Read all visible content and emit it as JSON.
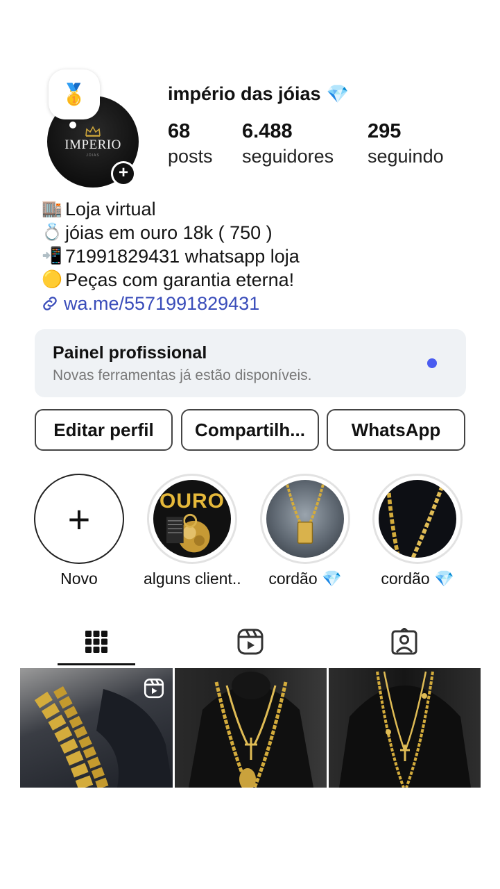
{
  "profile": {
    "username": "império das jóias",
    "verified_emoji": "💎",
    "note_emoji": "🥇",
    "avatar_text": "IMPERIO",
    "avatar_subtext": "JÓIAS",
    "stats": [
      {
        "value": "68",
        "label": "posts"
      },
      {
        "value": "6.488",
        "label": "seguidores"
      },
      {
        "value": "295",
        "label": "seguindo"
      }
    ]
  },
  "bio": {
    "lines": [
      {
        "emoji": "🏬",
        "text": "Loja virtual"
      },
      {
        "emoji": "💍",
        "text": "jóias em ouro 18k ( 750 )"
      },
      {
        "emoji": "📲",
        "text": " 71991829431 whatsapp loja"
      },
      {
        "emoji": "🟡",
        "text": " Peças com garantia eterna!"
      }
    ],
    "link": "wa.me/5571991829431"
  },
  "panel": {
    "title": "Painel profissional",
    "subtitle": "Novas ferramentas já estão disponíveis."
  },
  "buttons": {
    "edit": "Editar perfil",
    "share": "Compartilh...",
    "whatsapp": "WhatsApp"
  },
  "highlights": [
    {
      "label": "Novo"
    },
    {
      "label": "alguns client...",
      "image_text": "OURO"
    },
    {
      "label": "cordão 💎"
    },
    {
      "label": "cordão 💎"
    }
  ],
  "tabs": [
    "grid-icon",
    "reels-icon",
    "tagged-icon"
  ],
  "colors": {
    "link": "#3a4dba",
    "panel_bg": "#eff2f5",
    "panel_dot": "#4a5cf0",
    "gold": "#d4ac3c"
  }
}
